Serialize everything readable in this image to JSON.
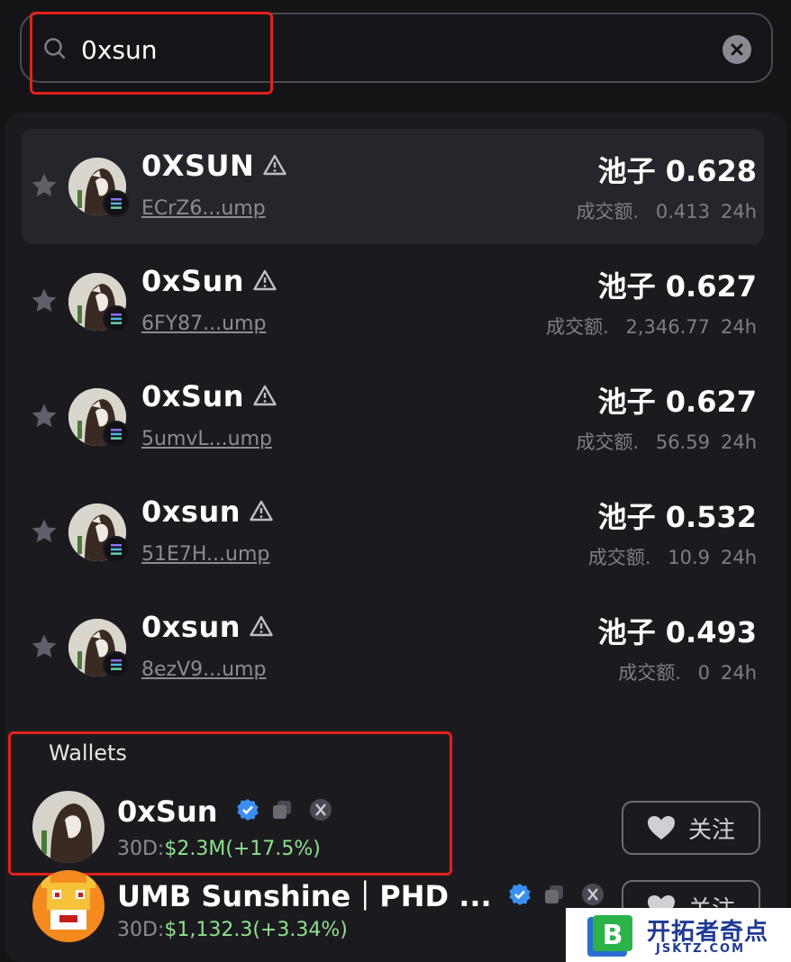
{
  "search": {
    "value": "0xsun",
    "placeholder": ""
  },
  "tokens": [
    {
      "name": "0XSUN",
      "address": "ECrZ6...ump",
      "pool_label": "池子",
      "pool": "0.628",
      "vol_label": "成交额.",
      "vol": "0.413",
      "period": "24h",
      "active": true
    },
    {
      "name": "0xSun",
      "address": "6FY87...ump",
      "pool_label": "池子",
      "pool": "0.627",
      "vol_label": "成交额.",
      "vol": "2,346.77",
      "period": "24h"
    },
    {
      "name": "0xSun",
      "address": "5umvL...ump",
      "pool_label": "池子",
      "pool": "0.627",
      "vol_label": "成交额.",
      "vol": "56.59",
      "period": "24h"
    },
    {
      "name": "0xsun",
      "address": "51E7H...ump",
      "pool_label": "池子",
      "pool": "0.532",
      "vol_label": "成交额.",
      "vol": "10.9",
      "period": "24h"
    },
    {
      "name": "0xsun",
      "address": "8ezV9...ump",
      "pool_label": "池子",
      "pool": "0.493",
      "vol_label": "成交额.",
      "vol": "0",
      "period": "24h"
    }
  ],
  "wallets_section": {
    "title": "Wallets"
  },
  "wallets": [
    {
      "name": "0xSun",
      "stats_prefix": "30D:",
      "pnl": "$2.3M",
      "pct": "(+17.5%)",
      "follow_label": "关注"
    },
    {
      "name": "UMB Sunshine｜PHD ...",
      "stats_prefix": "30D:",
      "pnl": "$1,132.3",
      "pct": "(+3.34%)",
      "follow_label": "关注"
    }
  ],
  "watermark": {
    "title": "开拓者奇点",
    "domain": "JSKTZ.COM"
  },
  "colors": {
    "background": "#141417",
    "panel": "#1b1b1f",
    "row_active": "#25262b",
    "highlight": "#e3211b",
    "positive": "#8ee08e",
    "verified": "#3b8ff3"
  }
}
